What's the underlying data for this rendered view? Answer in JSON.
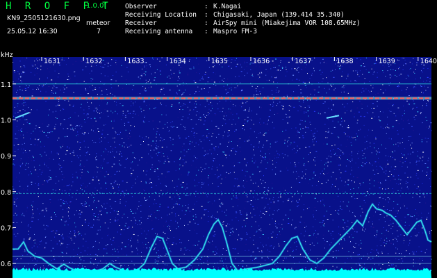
{
  "app": {
    "title": "H R O F F T",
    "version": "1.0.0f",
    "file_name": "KN9_2505121630.png",
    "date_time": "25.05.12 16:30",
    "mode_label": "meteor",
    "mode_value": "7"
  },
  "info": [
    {
      "label": "Observer",
      "value": "K.Nagai"
    },
    {
      "label": "Receiving Location",
      "value": "Chigasaki, Japan (139.414 35.340)"
    },
    {
      "label": "Receiver",
      "value": "AirSpy mini (Miakejima VOR 108.65MHz)"
    },
    {
      "label": "Receiving antenna",
      "value": "Maspro FM-3"
    }
  ],
  "chart_data": {
    "type": "heatmap",
    "title": "",
    "ylabel": "kHz",
    "xlabel": "",
    "x_ticks": [
      "1631",
      "1632",
      "1633",
      "1634",
      "1635",
      "1636",
      "1637",
      "1638",
      "1639",
      "1640"
    ],
    "y_ticks": [
      "1.1",
      "1.0",
      "0.9",
      "0.8",
      "0.7",
      "0.6"
    ],
    "ylim": [
      0.575,
      1.175
    ],
    "colors": {
      "background": "#000000",
      "spectrogram_base": "#08118a",
      "carrier_line": "#ff5a5a",
      "trace_line": "#35e6e6",
      "noise_floor": "#00ffff",
      "labels": "#ffffff"
    }
  }
}
